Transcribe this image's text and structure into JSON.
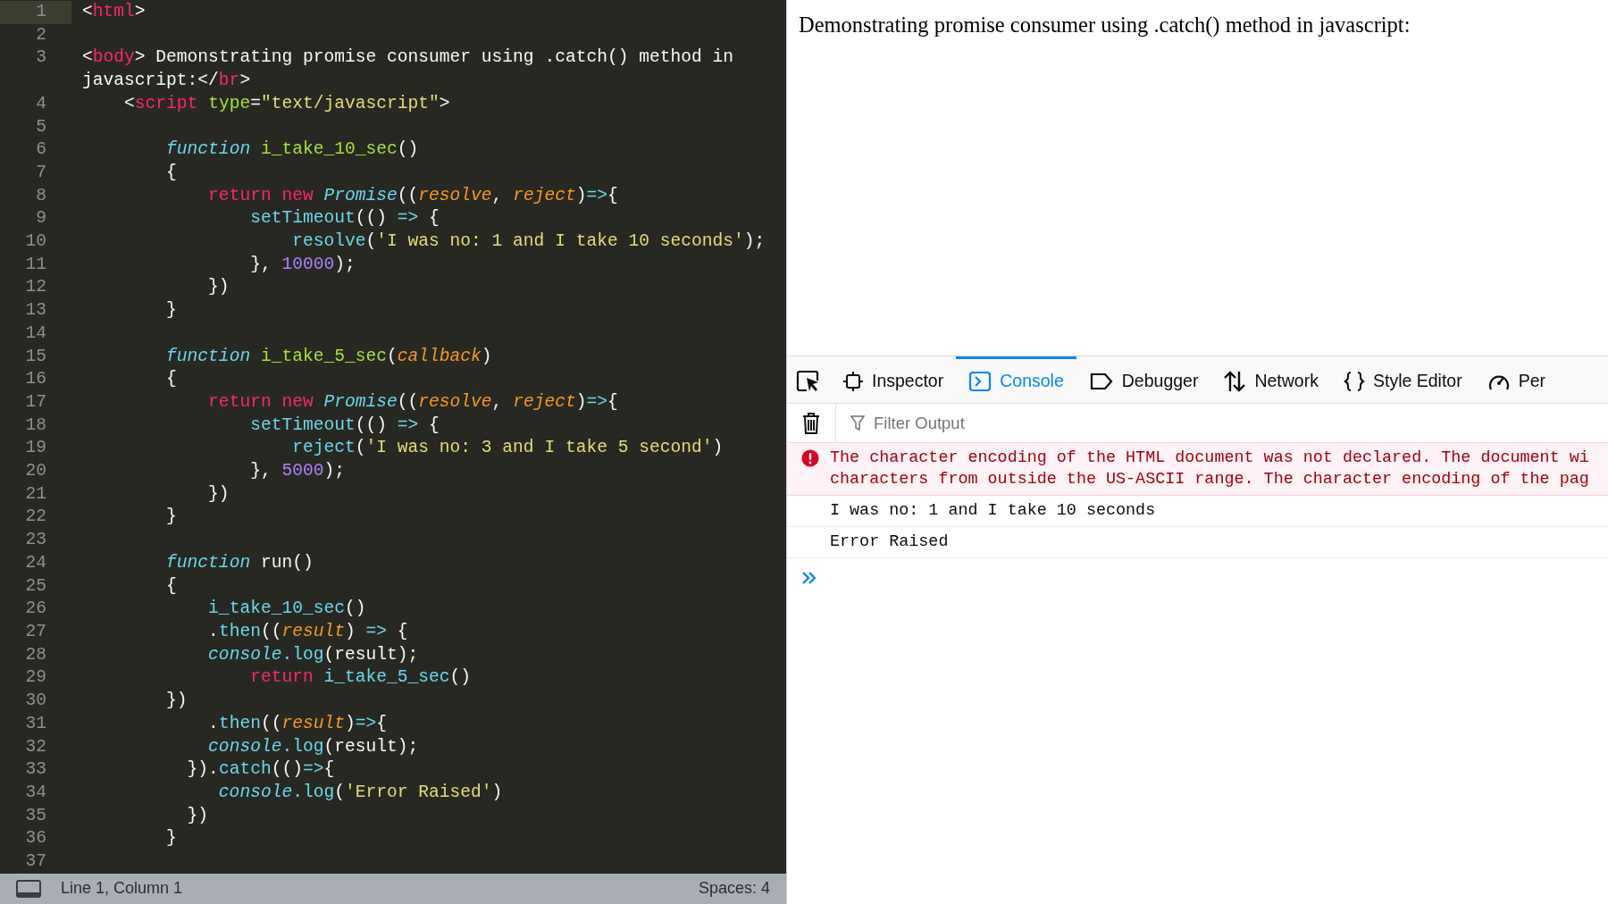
{
  "editor": {
    "lines": [
      {
        "num": "1",
        "current": true,
        "tokens": [
          {
            "kind": "plain",
            "text": "<"
          },
          {
            "kind": "tag",
            "text": "html"
          },
          {
            "kind": "plain",
            "text": ">"
          }
        ]
      },
      {
        "num": "2",
        "current": false
      },
      {
        "num": "3",
        "current": false,
        "tokens": [
          {
            "kind": "plain",
            "text": "<"
          },
          {
            "kind": "tag",
            "text": "body"
          },
          {
            "kind": "plain",
            "text": "> Demonstrating promise consumer using .catch() method in javascript:</"
          },
          {
            "kind": "tag",
            "text": "br"
          },
          {
            "kind": "plain",
            "text": ">"
          }
        ]
      },
      {
        "num": "4",
        "current": false,
        "tokens": [
          {
            "kind": "plain",
            "text": "    <"
          },
          {
            "kind": "tag",
            "text": "script "
          },
          {
            "kind": "attr",
            "text": "type"
          },
          {
            "kind": "plain",
            "text": "="
          },
          {
            "kind": "string",
            "text": "\"text/javascript\""
          },
          {
            "kind": "plain",
            "text": ">"
          }
        ]
      },
      {
        "num": "5",
        "current": false
      },
      {
        "num": "6",
        "current": false,
        "tokens": [
          {
            "kind": "storage",
            "text": "        function "
          },
          {
            "kind": "func",
            "text": "i_take_10_sec"
          },
          {
            "kind": "plain",
            "text": "()"
          }
        ]
      },
      {
        "num": "7",
        "current": false,
        "tokens": [
          {
            "kind": "plain",
            "text": "        {"
          }
        ]
      },
      {
        "num": "8",
        "current": false,
        "tokens": [
          {
            "kind": "keyword",
            "text": "            return new "
          },
          {
            "kind": "class",
            "text": "Promise"
          },
          {
            "kind": "plain",
            "text": "(("
          },
          {
            "kind": "param",
            "text": "resolve"
          },
          {
            "kind": "plain",
            "text": ", "
          },
          {
            "kind": "param",
            "text": "reject"
          },
          {
            "kind": "plain",
            "text": ")"
          },
          {
            "kind": "support",
            "text": "=>"
          },
          {
            "kind": "plain",
            "text": "{"
          }
        ]
      },
      {
        "num": "9",
        "current": false,
        "tokens": [
          {
            "kind": "support",
            "text": "                setTimeout"
          },
          {
            "kind": "plain",
            "text": "(() "
          },
          {
            "kind": "support",
            "text": "=>"
          },
          {
            "kind": "plain",
            "text": " {"
          }
        ]
      },
      {
        "num": "10",
        "current": false,
        "tokens": [
          {
            "kind": "support",
            "text": "                    resolve"
          },
          {
            "kind": "plain",
            "text": "("
          },
          {
            "kind": "string",
            "text": "'I was no: 1 and I take 10 seconds'"
          },
          {
            "kind": "plain",
            "text": ");"
          }
        ]
      },
      {
        "num": "11",
        "current": false,
        "tokens": [
          {
            "kind": "plain",
            "text": "                }, "
          },
          {
            "kind": "number",
            "text": "10000"
          },
          {
            "kind": "plain",
            "text": ");"
          }
        ]
      },
      {
        "num": "12",
        "current": false,
        "tokens": [
          {
            "kind": "plain",
            "text": "            })"
          }
        ]
      },
      {
        "num": "13",
        "current": false,
        "tokens": [
          {
            "kind": "plain",
            "text": "        }"
          }
        ]
      },
      {
        "num": "14",
        "current": false
      },
      {
        "num": "15",
        "current": false,
        "tokens": [
          {
            "kind": "storage",
            "text": "        function "
          },
          {
            "kind": "func",
            "text": "i_take_5_sec"
          },
          {
            "kind": "plain",
            "text": "("
          },
          {
            "kind": "param",
            "text": "callback"
          },
          {
            "kind": "plain",
            "text": ")"
          }
        ]
      },
      {
        "num": "16",
        "current": false,
        "tokens": [
          {
            "kind": "plain",
            "text": "        {"
          }
        ]
      },
      {
        "num": "17",
        "current": false,
        "tokens": [
          {
            "kind": "keyword",
            "text": "            return new "
          },
          {
            "kind": "class",
            "text": "Promise"
          },
          {
            "kind": "plain",
            "text": "(("
          },
          {
            "kind": "param",
            "text": "resolve"
          },
          {
            "kind": "plain",
            "text": ", "
          },
          {
            "kind": "param",
            "text": "reject"
          },
          {
            "kind": "plain",
            "text": ")"
          },
          {
            "kind": "support",
            "text": "=>"
          },
          {
            "kind": "plain",
            "text": "{"
          }
        ]
      },
      {
        "num": "18",
        "current": false,
        "tokens": [
          {
            "kind": "support",
            "text": "                setTimeout"
          },
          {
            "kind": "plain",
            "text": "(() "
          },
          {
            "kind": "support",
            "text": "=>"
          },
          {
            "kind": "plain",
            "text": " {"
          }
        ]
      },
      {
        "num": "19",
        "current": false,
        "tokens": [
          {
            "kind": "support",
            "text": "                    reject"
          },
          {
            "kind": "plain",
            "text": "("
          },
          {
            "kind": "string",
            "text": "'I was no: 3 and I take 5 second'"
          },
          {
            "kind": "plain",
            "text": ")"
          }
        ]
      },
      {
        "num": "20",
        "current": false,
        "tokens": [
          {
            "kind": "plain",
            "text": "                }, "
          },
          {
            "kind": "number",
            "text": "5000"
          },
          {
            "kind": "plain",
            "text": ");"
          }
        ]
      },
      {
        "num": "21",
        "current": false,
        "tokens": [
          {
            "kind": "plain",
            "text": "            })"
          }
        ]
      },
      {
        "num": "22",
        "current": false,
        "tokens": [
          {
            "kind": "plain",
            "text": "        }"
          }
        ]
      },
      {
        "num": "23",
        "current": false
      },
      {
        "num": "24",
        "current": false,
        "tokens": [
          {
            "kind": "storage",
            "text": "        function "
          },
          {
            "kind": "plain",
            "text": "run()"
          }
        ]
      },
      {
        "num": "25",
        "current": false,
        "tokens": [
          {
            "kind": "plain",
            "text": "        {"
          }
        ]
      },
      {
        "num": "26",
        "current": false,
        "tokens": [
          {
            "kind": "support",
            "text": "            i_take_10_sec"
          },
          {
            "kind": "plain",
            "text": "()"
          }
        ]
      },
      {
        "num": "27",
        "current": false,
        "tokens": [
          {
            "kind": "plain",
            "text": "            ."
          },
          {
            "kind": "support",
            "text": "then"
          },
          {
            "kind": "plain",
            "text": "(("
          },
          {
            "kind": "param",
            "text": "result"
          },
          {
            "kind": "plain",
            "text": ") "
          },
          {
            "kind": "support",
            "text": "=>"
          },
          {
            "kind": "plain",
            "text": " {"
          }
        ]
      },
      {
        "num": "28",
        "current": false,
        "tokens": [
          {
            "kind": "class",
            "text": "            console"
          },
          {
            "kind": "support",
            "text": ".log"
          },
          {
            "kind": "plain",
            "text": "(result);"
          }
        ]
      },
      {
        "num": "29",
        "current": false,
        "tokens": [
          {
            "kind": "keyword",
            "text": "                return "
          },
          {
            "kind": "support",
            "text": "i_take_5_sec"
          },
          {
            "kind": "plain",
            "text": "()"
          }
        ]
      },
      {
        "num": "30",
        "current": false,
        "tokens": [
          {
            "kind": "plain",
            "text": "        })"
          }
        ]
      },
      {
        "num": "31",
        "current": false,
        "tokens": [
          {
            "kind": "plain",
            "text": "            ."
          },
          {
            "kind": "support",
            "text": "then"
          },
          {
            "kind": "plain",
            "text": "(("
          },
          {
            "kind": "param",
            "text": "result"
          },
          {
            "kind": "plain",
            "text": ")"
          },
          {
            "kind": "support",
            "text": "=>"
          },
          {
            "kind": "plain",
            "text": "{"
          }
        ]
      },
      {
        "num": "32",
        "current": false,
        "tokens": [
          {
            "kind": "class",
            "text": "            console"
          },
          {
            "kind": "support",
            "text": ".log"
          },
          {
            "kind": "plain",
            "text": "(result);"
          }
        ]
      },
      {
        "num": "33",
        "current": false,
        "tokens": [
          {
            "kind": "plain",
            "text": "          })."
          },
          {
            "kind": "support",
            "text": "catch"
          },
          {
            "kind": "plain",
            "text": "(()"
          },
          {
            "kind": "support",
            "text": "=>"
          },
          {
            "kind": "plain",
            "text": "{"
          }
        ]
      },
      {
        "num": "34",
        "current": false,
        "tokens": [
          {
            "kind": "class",
            "text": "             console"
          },
          {
            "kind": "support",
            "text": ".log"
          },
          {
            "kind": "plain",
            "text": "("
          },
          {
            "kind": "string",
            "text": "'Error Raised'"
          },
          {
            "kind": "plain",
            "text": ")"
          }
        ]
      },
      {
        "num": "35",
        "current": false,
        "tokens": [
          {
            "kind": "plain",
            "text": "          })"
          }
        ]
      },
      {
        "num": "36",
        "current": false,
        "tokens": [
          {
            "kind": "plain",
            "text": "        }"
          }
        ]
      },
      {
        "num": "37",
        "current": false
      }
    ]
  },
  "status_bar": {
    "position": "Line 1, Column 1",
    "indentation": "Spaces: 4"
  },
  "browser": {
    "page_text": "Demonstrating promise consumer using .catch() method in javascript:"
  },
  "devtools": {
    "tabs": [
      {
        "kind": "inspector",
        "label": "Inspector",
        "selected": false
      },
      {
        "kind": "console",
        "label": "Console",
        "selected": true
      },
      {
        "kind": "debugger",
        "label": "Debugger",
        "selected": false
      },
      {
        "kind": "network",
        "label": "Network",
        "selected": false
      },
      {
        "kind": "style",
        "label": "Style Editor",
        "selected": false
      },
      {
        "kind": "performance",
        "label": "Per",
        "selected": false
      }
    ],
    "filter": {
      "placeholder": "Filter Output"
    },
    "messages": [
      {
        "kind": "error",
        "lines": [
          "The character encoding of the HTML document was not declared. The document wi",
          "characters from outside the US-ASCII range. The character encoding of the pag"
        ]
      },
      {
        "kind": "log",
        "lines": [
          "I was no: 1 and I take 10 seconds"
        ]
      },
      {
        "kind": "log",
        "lines": [
          "Error Raised"
        ]
      }
    ]
  }
}
